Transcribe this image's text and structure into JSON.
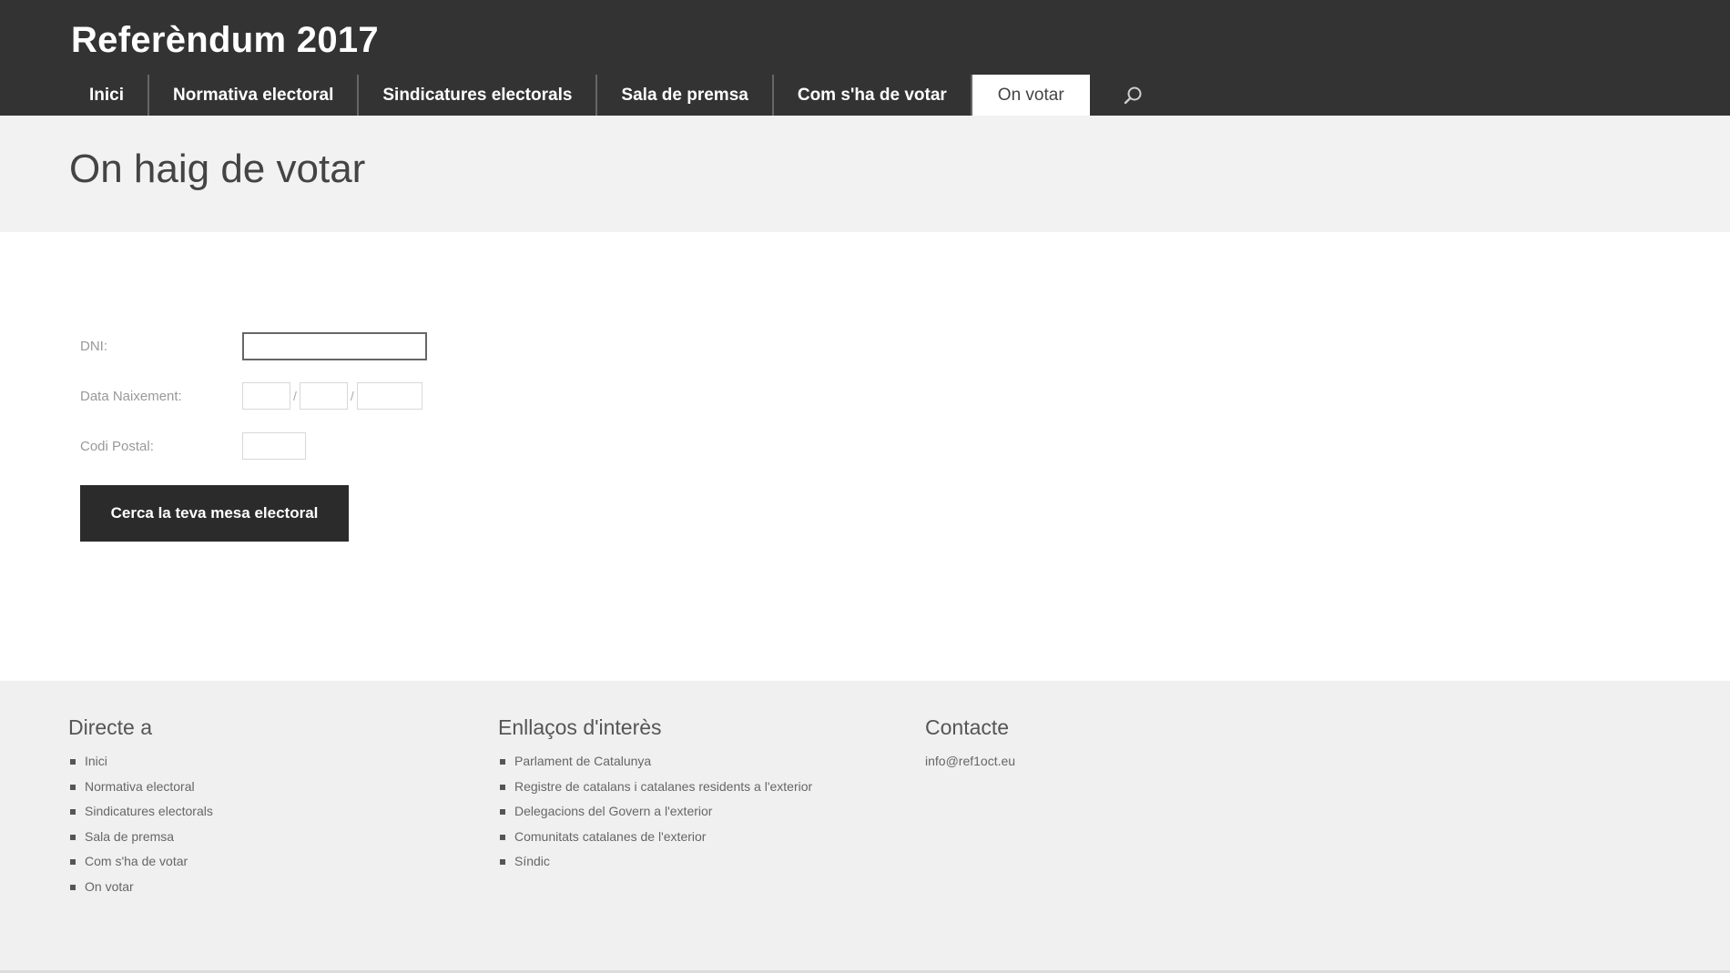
{
  "site": {
    "title": "Referèndum 2017"
  },
  "nav": {
    "items": [
      "Inici",
      "Normativa electoral",
      "Sindicatures electorals",
      "Sala de premsa",
      "Com s'ha de votar",
      "On votar"
    ],
    "active_index": 5,
    "search_icon": "search-icon"
  },
  "page": {
    "title": "On haig de votar"
  },
  "form": {
    "dni_label": "DNI:",
    "dni_value": "",
    "birth_label": "Data Naixement:",
    "birth_separator": "/",
    "birth_day": "",
    "birth_month": "",
    "birth_year": "",
    "postal_label": "Codi Postal:",
    "postal_value": "",
    "submit_label": "Cerca la teva mesa electoral"
  },
  "footer": {
    "col1": {
      "title": "Directe a",
      "items": [
        "Inici",
        "Normativa electoral",
        "Sindicatures electorals",
        "Sala de premsa",
        "Com s'ha de votar",
        "On votar"
      ]
    },
    "col2": {
      "title": "Enllaços d'interès",
      "items": [
        "Parlament de Catalunya",
        "Registre de catalans i catalanes residents a l'exterior",
        "Delegacions del Govern a l'exterior",
        "Comunitats catalanes de l'exterior",
        "Síndic"
      ]
    },
    "col3": {
      "title": "Contacte",
      "email": "info@ref1oct.eu"
    }
  },
  "colors": {
    "header_bg": "#333333",
    "title_band_bg": "#f2f2f2",
    "footer_bg": "#f0f0f0",
    "button_bg": "#2b2b2b"
  }
}
